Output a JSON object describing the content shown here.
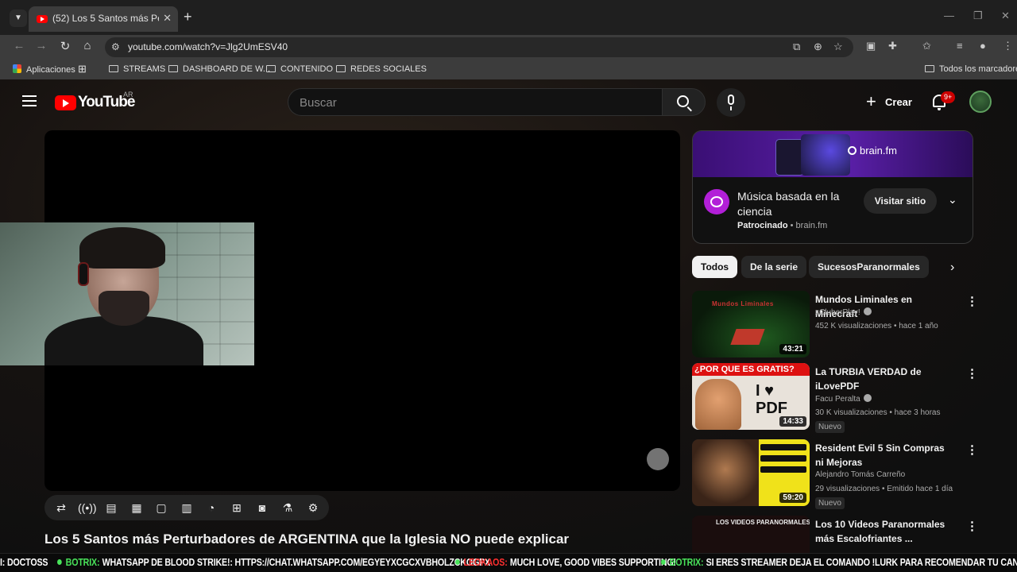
{
  "browser": {
    "tab_title": "(52) Los 5 Santos más Perturbad",
    "new_tab_label": "+",
    "url": "youtube.com/watch?v=Jlg2UmESV40",
    "bookmarks": [
      "Aplicaciones",
      "STREAMS",
      "DASHBOARD DE W...",
      "CONTENIDO",
      "REDES SOCIALES"
    ],
    "all_bookmarks": "Todos los marcadores"
  },
  "youtube": {
    "logo_text": "YouTube",
    "region": "AR",
    "search_placeholder": "Buscar",
    "create_label": "Crear",
    "notifications": "9+"
  },
  "video": {
    "title": "Los 5 Santos más Perturbadores de ARGENTINA que la Iglesia NO puede explicar"
  },
  "ad": {
    "brand": "brain.fm",
    "title": "Música basada en la ciencia",
    "sponsored": "Patrocinado",
    "domain": "brain.fm",
    "cta": "Visitar sitio"
  },
  "chips": [
    "Todos",
    "De la serie",
    "SucesosParanormales"
  ],
  "recommendations": [
    {
      "title": "Mundos Liminales en Minecraft",
      "channel": "xCluberPlay!",
      "views": "452 K visualizaciones",
      "age": "hace 1 año",
      "duration": "43:21",
      "badge": "",
      "thumb_text": "Mundos Liminales"
    },
    {
      "title": "La TURBIA VERDAD de iLovePDF",
      "channel": "Facu Peralta",
      "views": "30 K visualizaciones",
      "age": "hace 3 horas",
      "duration": "14:33",
      "badge": "Nuevo",
      "thumb_text": "¿POR QUE ES GRATIS?"
    },
    {
      "title": "Resident Evil 5 Sin Compras ni Mejoras",
      "channel": "Alejandro Tomás Carreño",
      "views": "29 visualizaciones",
      "age": "Emitido hace 1 día",
      "duration": "59:20",
      "badge": "Nuevo",
      "thumb_text": ""
    },
    {
      "title": "Los 10 Videos Paranormales más Escalofriantes ...",
      "channel": "",
      "views": "",
      "age": "",
      "duration": "",
      "badge": "",
      "thumb_text": "LOS VIDEOS PARANORMALES"
    }
  ],
  "ticker": [
    {
      "user": "",
      "message": "I: DOCTOSS"
    },
    {
      "user": "BOTRIX:",
      "message": "WHATSAPP DE BLOOD STRIKE!: HTTPS://CHAT.WHATSAPP.COM/EGYEYXCGCXVBHOLZCKOGPX"
    },
    {
      "user": "LEOKAOS:",
      "message": "MUCH LOVE, GOOD VIBES SUPPORTING!"
    },
    {
      "user": "BOTRIX:",
      "message": "SI ERES STREAMER DEJA EL COMANDO !LURK PARA RECOMENDAR TU CANAL! 💚"
    }
  ],
  "colors": {
    "user_green": "#49e35a",
    "user_red": "#ff3030",
    "youtube_red": "#ff0000"
  }
}
